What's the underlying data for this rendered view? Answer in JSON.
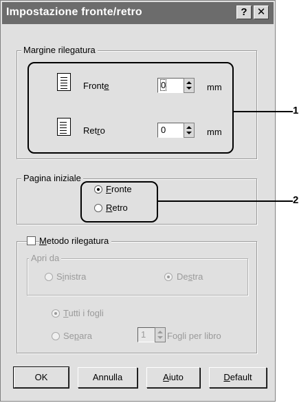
{
  "window": {
    "title": "Impostazione fronte/retro",
    "help_glyph": "?",
    "close_glyph": "✕"
  },
  "margin_group": {
    "legend": "Margine rilegatura",
    "front": {
      "label_pre": "Front",
      "label_u": "e",
      "value": "0",
      "unit": "mm"
    },
    "back": {
      "label_pre": "Ret",
      "label_u": "r",
      "label_post": "o",
      "value": "0",
      "unit": "mm"
    }
  },
  "start_page_group": {
    "legend": "Pagina iniziale",
    "front": {
      "label_u": "F",
      "label_rest": "ronte",
      "selected": true
    },
    "back": {
      "label_u": "R",
      "label_rest": "etro",
      "selected": false
    }
  },
  "binding_method": {
    "checkbox_pre": "",
    "checkbox_u": "M",
    "checkbox_rest": "etodo rilegatura",
    "checked": false,
    "open_from": {
      "legend": "Apri da",
      "left": {
        "pre": "S",
        "u": "i",
        "rest": "nistra",
        "selected": false
      },
      "right": {
        "pre": "De",
        "u": "s",
        "rest": "tra",
        "selected": true
      }
    },
    "all_sheets": {
      "u": "T",
      "rest": "utti i fogli",
      "selected": true
    },
    "separate": {
      "pre": "Se",
      "u": "p",
      "rest": "ara",
      "selected": false
    },
    "sheets_value": "1",
    "sheets_label": "Fogli per libro"
  },
  "buttons": {
    "ok": "OK",
    "cancel": "Annulla",
    "help_u": "A",
    "help_rest": "iuto",
    "default_u": "D",
    "default_rest": "efault"
  },
  "callouts": {
    "one": "1",
    "two": "2"
  }
}
